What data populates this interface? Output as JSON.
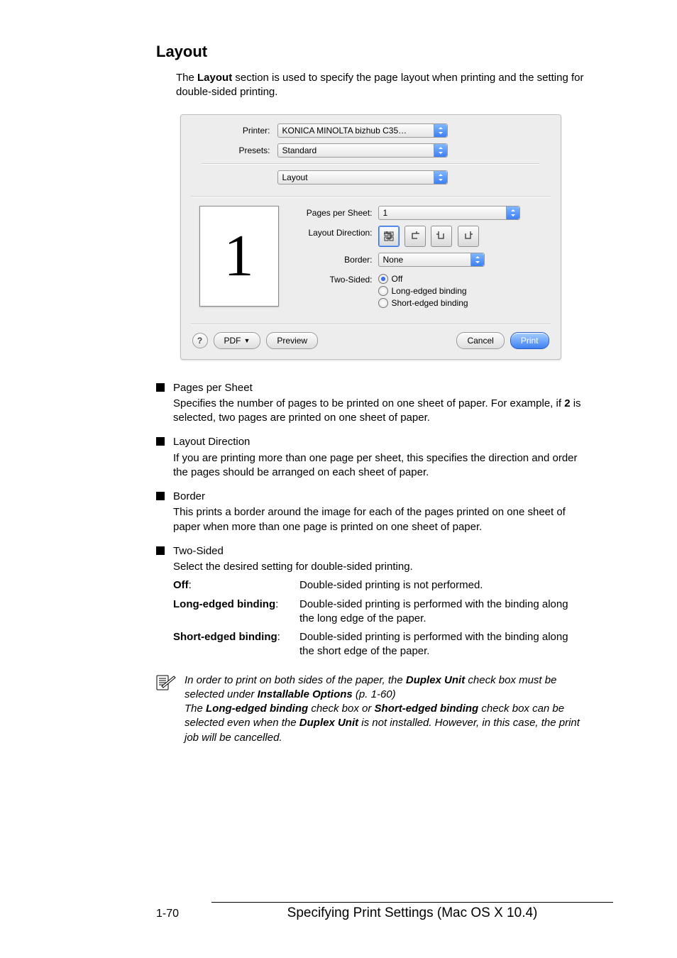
{
  "section_title": "Layout",
  "intro_parts": [
    "The ",
    "Layout",
    " section is used to specify the page layout when printing and the setting for double-sided printing."
  ],
  "dialog": {
    "printer_label": "Printer:",
    "printer_value": "KONICA MINOLTA bizhub C35…",
    "presets_label": "Presets:",
    "presets_value": "Standard",
    "pane_value": "Layout",
    "pages_per_sheet_label": "Pages per Sheet:",
    "pages_per_sheet_value": "1",
    "layout_direction_label": "Layout Direction:",
    "border_label": "Border:",
    "border_value": "None",
    "two_sided_label": "Two-Sided:",
    "two_sided_options": [
      "Off",
      "Long-edged binding",
      "Short-edged binding"
    ],
    "preview_glyph": "1",
    "help_label": "?",
    "pdf_label": "PDF",
    "preview_label": "Preview",
    "cancel_label": "Cancel",
    "print_label": "Print"
  },
  "bullets": {
    "pages_per_sheet_title": "Pages per Sheet",
    "pages_per_sheet_desc_parts": [
      "Specifies the number of pages to be printed on one sheet of paper. For example, if ",
      "2",
      " is selected, two pages are printed on one sheet of paper."
    ],
    "layout_direction_title": "Layout Direction",
    "layout_direction_desc": "If you are printing more than one page per sheet, this specifies the direction and order the pages should be arranged on each sheet of paper.",
    "border_title": "Border",
    "border_desc": "This prints a border around the image for each of the pages printed on one sheet of paper when more than one page is printed on one sheet of paper.",
    "two_sided_title": "Two-Sided",
    "two_sided_intro": "Select the desired setting for double-sided printing.",
    "def_off_term": "Off",
    "def_off_colon": ":",
    "def_off_desc": "Double-sided printing is not performed.",
    "def_long_term": "Long-edged binding",
    "def_long_colon": ":",
    "def_long_desc": "Double-sided printing is performed with the binding along the long edge of the paper.",
    "def_short_term": "Short-edged binding",
    "def_short_colon": ":",
    "def_short_desc": "Double-sided printing is performed with the binding along the short edge of the paper."
  },
  "note": {
    "l1a": "In order to print on both sides of the paper, the ",
    "l1b": "Duplex Unit",
    "l1c": " check box must be selected under ",
    "l1d": "Installable Options",
    "l1e": " (p. 1-60)",
    "l2a": "The ",
    "l2b": "Long-edged binding",
    "l2c": " check box or ",
    "l2d": "Short-edged binding",
    "l2e": " check box can be selected even when the ",
    "l2f": "Duplex Unit",
    "l2g": " is not installed. However, in this case, the print job will be cancelled."
  },
  "footer": {
    "page": "1-70",
    "title": "Specifying Print Settings (Mac OS X 10.4)"
  }
}
